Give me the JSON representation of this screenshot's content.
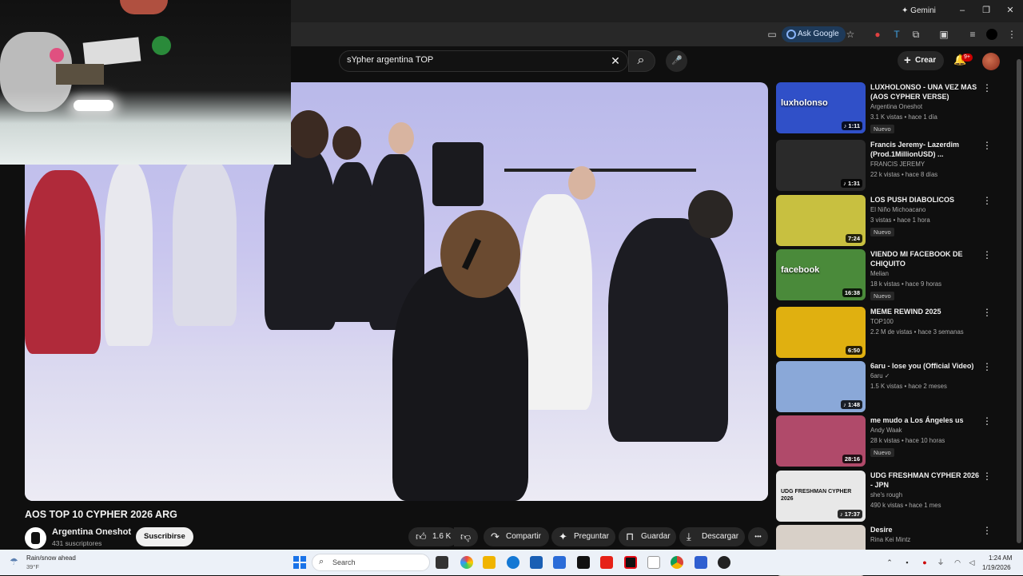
{
  "browser": {
    "gemini_label": "Gemini",
    "ask_google_label": "Ask Google",
    "window_controls": {
      "minimize": "–",
      "restore": "❐",
      "close": "✕"
    }
  },
  "header": {
    "search_value": "sYpher argentina TOP",
    "clear_icon": "✕",
    "search_icon": "⌕",
    "mic_icon": "🎤",
    "create_label": "Crear",
    "create_plus": "+",
    "notification_badge": "9+",
    "bell_icon": "🔔"
  },
  "video": {
    "title": "AOS TOP 10 CYPHER 2026 ARG",
    "channel_name": "Argentina Oneshot",
    "channel_subs": "431 suscriptores",
    "subscribe_label": "Suscribirse",
    "like_count": "1.6 K",
    "share_label": "Compartir",
    "ask_label": "Preguntar",
    "save_label": "Guardar",
    "download_label": "Descargar",
    "more_label": "•••"
  },
  "sidebar": {
    "items": [
      {
        "title": "LUXHOLONSO - UNA VEZ MAS (AOS CYPHER VERSE)",
        "channel": "Argentina Oneshot",
        "meta": "3.1 K vistas • hace 1 día",
        "duration": "♪ 1:11",
        "badge": "Nuevo",
        "thumb_text": "luxholonso",
        "thumb_color": "#3050c8"
      },
      {
        "title": "Francis Jeremy- Lazerdim (Prod.1MillionUSD) ...",
        "channel": "FRANCIS JEREMY",
        "meta": "22 k vistas • hace 8 días",
        "duration": "♪ 1:31",
        "badge": "",
        "thumb_text": "",
        "thumb_color": "#2a2a2a"
      },
      {
        "title": "LOS PUSH DIABOLICOS",
        "channel": "El Niño Michoacano",
        "meta": "3 vistas • hace 1 hora",
        "duration": "7:24",
        "badge": "Nuevo",
        "thumb_text": "",
        "thumb_color": "#c8c040"
      },
      {
        "title": "VIENDO MI FACEBOOK DE CHIQUITO",
        "channel": "Melian",
        "meta": "18 k vistas • hace 9 horas",
        "duration": "16:38",
        "badge": "Nuevo",
        "thumb_text": "facebook",
        "thumb_color": "#4a8a3a"
      },
      {
        "title": "MEME REWIND 2025",
        "channel": "TOP100",
        "meta": "2.2 M de vistas • hace 3 semanas",
        "duration": "6:50",
        "badge": "",
        "thumb_text": "",
        "thumb_color": "#e0b010"
      },
      {
        "title": "6aru - lose you (Official Video)",
        "channel": "6aru ✓",
        "meta": "1.5 K vistas • hace 2 meses",
        "duration": "♪ 1:48",
        "badge": "",
        "thumb_text": "",
        "thumb_color": "#8aa8d8"
      },
      {
        "title": "me mudo a Los Ángeles us",
        "channel": "Andy Waak",
        "meta": "28 k vistas • hace 10 horas",
        "duration": "28:16",
        "badge": "Nuevo",
        "thumb_text": "",
        "thumb_color": "#b04a6a"
      },
      {
        "title": "UDG FRESHMAN CYPHER 2026 - JPN",
        "channel": "she's rough",
        "meta": "490 k vistas • hace 1 mes",
        "duration": "♪ 17:37",
        "badge": "",
        "thumb_text": "UDG FRESHMAN CYPHER 2026",
        "thumb_color": "#e8e8e8"
      },
      {
        "title": "Desire",
        "channel": "Rina Kei Mintz",
        "meta": "",
        "duration": "",
        "badge": "",
        "thumb_text": "",
        "thumb_color": "#d8d0c8"
      }
    ]
  },
  "taskbar": {
    "weather_label": "Rain/snow ahead",
    "weather_temp": "39°F",
    "search_placeholder": "Search",
    "time": "1:24 AM",
    "date": "1/19/2026"
  },
  "colors": {
    "background": "#0f0f0f",
    "accent_red": "#cc0000",
    "taskbar": "#ecf1f8"
  }
}
